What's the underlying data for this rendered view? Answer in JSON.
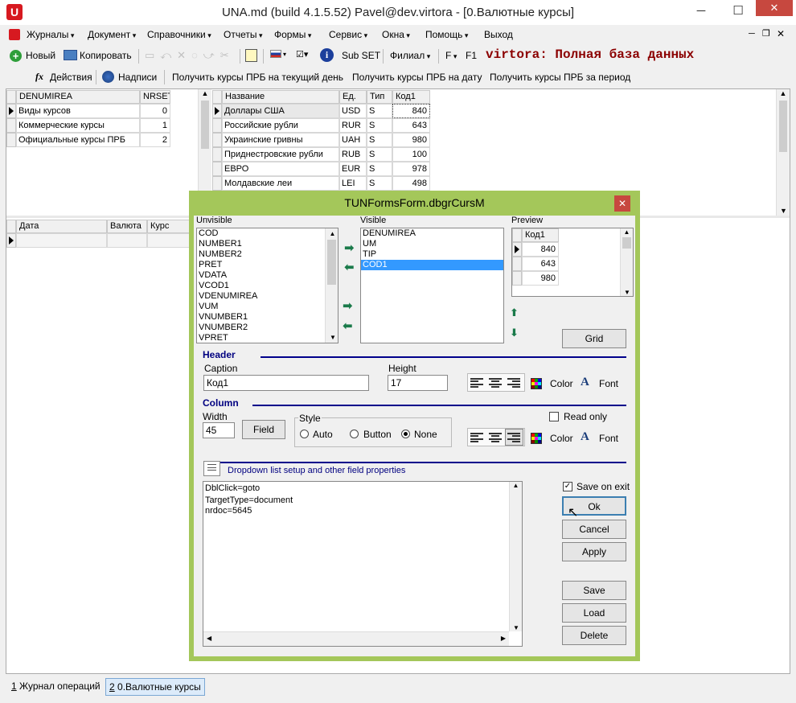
{
  "window": {
    "title": "UNA.md (build 4.1.5.52) Pavel@dev.virtora - [0.Валютные курсы]",
    "app_icon": "U"
  },
  "menu": {
    "items": [
      "Журналы",
      "Документ",
      "Справочники",
      "Отчеты",
      "Формы",
      "Сервис",
      "Окна",
      "Помощь",
      "Выход"
    ]
  },
  "toolbar": {
    "new_label": "Новый",
    "copy_label": "Копировать",
    "subset_label": "Sub SET",
    "filial_label": "Филиал",
    "f_label": "F",
    "f1_label": "F1",
    "db_banner": "virtora: Полная база данных"
  },
  "actionbar": {
    "actions_label": "Действия",
    "captions_label": "Надписи",
    "btn1": "Получить курсы ПРБ на текущий день",
    "btn2": "Получить курсы ПРБ на дату",
    "btn3": "Получить курсы ПРБ за период"
  },
  "grid_types": {
    "headers": [
      "DENUMIREA",
      "NRSET"
    ],
    "rows": [
      [
        "Виды курсов",
        "0"
      ],
      [
        "Коммерческие курсы",
        "1"
      ],
      [
        "Официальные курсы ПРБ",
        "2"
      ]
    ]
  },
  "grid_currencies": {
    "headers": [
      "Название",
      "Ед.",
      "Тип",
      "Код1"
    ],
    "rows": [
      [
        "Доллары США",
        "USD",
        "S",
        "840"
      ],
      [
        "Российские рубли",
        "RUR",
        "S",
        "643"
      ],
      [
        "Украинские гривны",
        "UAH",
        "S",
        "980"
      ],
      [
        "Приднестровские рубли",
        "RUB",
        "S",
        "100"
      ],
      [
        "ЕВРО",
        "EUR",
        "S",
        "978"
      ],
      [
        "Молдавские леи",
        "LEI",
        "S",
        "498"
      ]
    ]
  },
  "grid_rates": {
    "headers": [
      "Дата",
      "Валюта",
      "Курс"
    ]
  },
  "dialog": {
    "title": "TUNFormsForm.dbgrCursM",
    "unvisible_label": "Unvisible",
    "visible_label": "Visible",
    "preview_label": "Preview",
    "unvisible_items": [
      "COD",
      "NUMBER1",
      "NUMBER2",
      "PRET",
      "VDATA",
      "VCOD1",
      "VDENUMIREA",
      "VUM",
      "VNUMBER1",
      "VNUMBER2",
      "VPRET"
    ],
    "visible_items": [
      "DENUMIREA",
      "UM",
      "TIP",
      "COD1"
    ],
    "preview_header": "Код1",
    "preview_values": [
      "840",
      "643",
      "980"
    ],
    "grid_button": "Grid",
    "header_heading": "Header",
    "caption_label": "Caption",
    "caption_value": "Код1",
    "height_label": "Height",
    "height_value": "17",
    "color_label": "Color",
    "font_label": "Font",
    "column_heading": "Column",
    "width_label": "Width",
    "width_value": "45",
    "field_button": "Field",
    "style_label": "Style",
    "style_auto": "Auto",
    "style_button": "Button",
    "style_none": "None",
    "readonly_label": "Read only",
    "dropdown_label": "Dropdown list setup and other field properties",
    "memo_lines": [
      "DblClick=goto",
      "TargetType=document",
      "nrdoc=5645"
    ],
    "save_on_exit_label": "Save on exit",
    "ok_button": "Ok",
    "cancel_button": "Cancel",
    "apply_button": "Apply",
    "save_button": "Save",
    "load_button": "Load",
    "delete_button": "Delete"
  },
  "tabs": {
    "tab1_num": "1",
    "tab1_label": "Журнал операций",
    "tab2_num": "2",
    "tab2_label": "0.Валютные курсы"
  },
  "colors": {
    "accent": "#a4c75a",
    "selection": "#3399ff",
    "banner": "#8b0000",
    "brand": "#d71920"
  }
}
